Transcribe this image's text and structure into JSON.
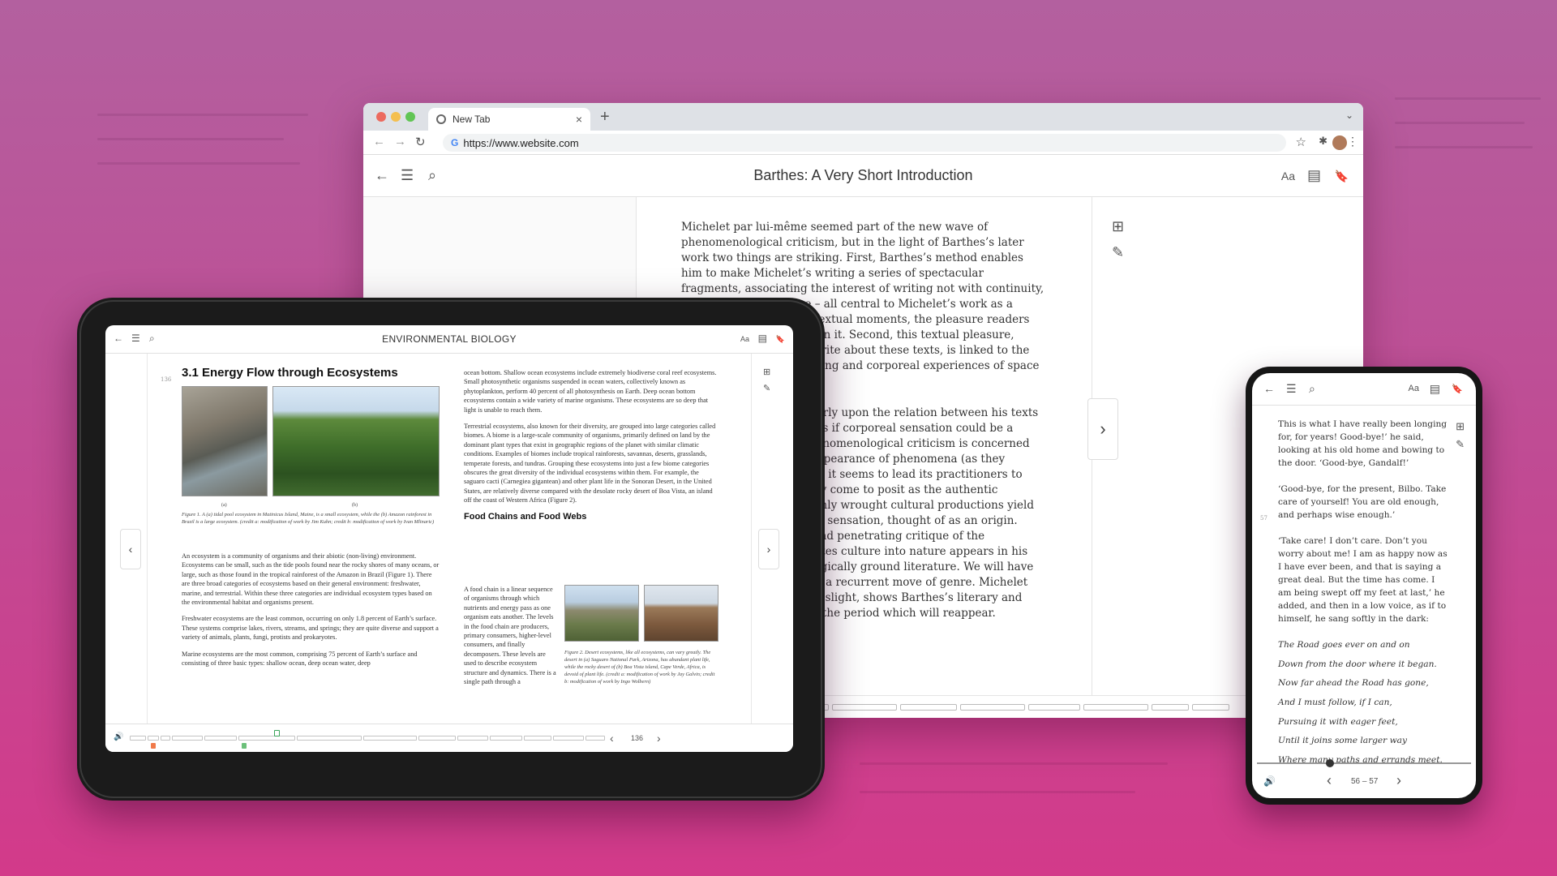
{
  "browser": {
    "tab_title": "New Tab",
    "tab_close": "×",
    "new_tab": "+",
    "tab_menu": "⌄",
    "url": "https://www.website.com",
    "google_letter": "G",
    "nav_back": "←",
    "nav_forward": "→",
    "nav_reload": "↻",
    "star": "☆",
    "extensions": "✱",
    "menu": "⋮"
  },
  "desktop_reader": {
    "title": "Barthes: A Very Short Introduction",
    "back_icon": "←",
    "toc_icon": "☰",
    "search_icon": "⌕",
    "font_icon": "Aa",
    "notes_icon": "▤",
    "bookmark_icon": "🔖",
    "add_note_icon": "⊞",
    "highlight_icon": "✎",
    "next_icon": "›",
    "paragraphs": [
      "Michelet par lui-même seemed part of the new wave of phenomenological criticism, but in the light of Barthes’s later work two things are striking. First, Barthes’s method enables him to make Michelet’s writing a series of spectacular fragments, associating the interest of writing not with continuity, development, structure – all central to Michelet’s work as a historian – but with the textual moments, the pleasure readers can get from odd details in it. Second, this textual pleasure, which leads Barthes to write about these texts, is linked to the body. A concern with feeling and corporeal experiences of space and time.",
      "Barthes focuses particularly upon the relation between his texts and bodily experiences, as if corporeal sensation could be a foundation. Although phenomenological criticism is concerned with the experience or appearance of phenomena (as they appear to consciousness), it seems to lead its practitioners to corporeal experience they come to posit as the authentic foundation. The most highly wrought cultural productions yield elementary, pre-reflective sensation, thought of as an origin. Barthes’s most incisive and penetrating critique of the mystification that translates culture into nature appears in his later works, which strategically ground literature. We will have to ask whether this is not a recurrent move of genre. Michelet par lui-même, apparently slight, shows Barthes’s literary and political commitments of the period which will reappear."
    ]
  },
  "tablet_reader": {
    "title": "ENVIRONMENTAL BIOLOGY",
    "back_icon": "←",
    "toc_icon": "☰",
    "search_icon": "⌕",
    "font_icon": "Aa",
    "notes_icon": "▤",
    "bookmark_icon": "🔖",
    "add_note_icon": "⊞",
    "highlight_icon": "✎",
    "prev_icon": "‹",
    "next_icon": "›",
    "page_label": "136",
    "page_margin_number": "136",
    "volume_icon": "🔊",
    "heading": "3.1 Energy Flow through Ecosystems",
    "photo_labels": [
      "(a)",
      "(b)"
    ],
    "figure1_caption": "Figure 1. A (a) tidal pool ecosystem in Matinicus Island, Maine, is a small ecosystem, while the (b) Amazon rainforest in Brazil is a large ecosystem. (credit a: modification of work by Jim Kuhn; credit b: modification of work by Ivan Mlinaric)",
    "left_paragraphs": [
      "An ecosystem is a community of organisms and their abiotic (non-living) environment. Ecosystems can be small, such as the tide pools found near the rocky shores of many oceans, or large, such as those found in the tropical rainforest of the Amazon in Brazil (Figure 1). There are three broad categories of ecosystems based on their general environment: freshwater, marine, and terrestrial. Within these three categories are individual ecosystem types based on the environmental habitat and organisms present.",
      "Freshwater ecosystems are the least common, occurring on only 1.8 percent of Earth’s surface. These systems comprise lakes, rivers, streams, and springs; they are quite diverse and support a variety of animals, plants, fungi, protists and prokaryotes.",
      "Marine ecosystems are the most common, comprising 75 percent of Earth’s surface and consisting of three basic types: shallow ocean, deep ocean water, deep"
    ],
    "right_paragraphs": [
      "ocean bottom. Shallow ocean ecosystems include extremely biodiverse coral reef ecosystems. Small photosynthetic organisms suspended in ocean waters, collectively known as phytoplankton, perform 40 percent of all photosynthesis on Earth. Deep ocean bottom ecosystems contain a wide variety of marine organisms. These ecosystems are so deep that light is unable to reach them.",
      "Terrestrial ecosystems, also known for their diversity, are grouped into large categories called biomes. A biome is a large-scale community of organisms, primarily defined on land by the dominant plant types that exist in geographic regions of the planet with similar climatic conditions. Examples of biomes include tropical rainforests, savannas, deserts, grasslands, temperate forests, and tundras. Grouping these ecosystems into just a few biome categories obscures the great diversity of the individual ecosystems within them. For example, the saguaro cacti (Carnegiea gigantean) and other plant life in the Sonoran Desert, in the United States, are relatively diverse compared with the desolate rocky desert of Boa Vista, an island off the coast of Western Africa (Figure 2)."
    ],
    "subheading": "Food Chains and Food Webs",
    "food_chain_text": "A food chain is a linear sequence of organisms through which nutrients and energy pass as one organism eats another. The levels in the food chain are producers, primary consumers, higher-level consumers, and finally decomposers. These levels are used to describe ecosystem structure and dynamics. There is a single path through a",
    "figure2_caption": "Figure 2. Desert ecosystems, like all ecosystems, can vary greatly. The desert in (a) Saguaro National Park, Arizona, has abundant plant life, while the rocky desert of (b) Boa Vista island, Cape Verde, Africa, is devoid of plant life. (credit a: modification of work by Jay Galvin; credit b: modification of work by Ingo Wolbern)",
    "colors": {
      "bookmark_orange": "#f07a4a",
      "highlight_green": "#6cc07a",
      "position_green": "#3aa55a"
    }
  },
  "phone_reader": {
    "back_icon": "←",
    "toc_icon": "☰",
    "search_icon": "⌕",
    "font_icon": "Aa",
    "notes_icon": "▤",
    "bookmark_icon": "🔖",
    "add_note_icon": "⊞",
    "highlight_icon": "✎",
    "margin_number": "57",
    "paragraphs": [
      "This is what I have really been longing for, for years! Good-bye!’ he said, looking at his old home and bowing to the door. ‘Good-bye, Gandalf!’",
      "‘Good-bye, for the present, Bilbo. Take care of yourself! You are old enough, and perhaps wise enough.’",
      "‘Take care! I don’t care. Don’t you worry about me! I am as happy now as I have ever been, and that is saying a great deal. But the time has come. I am being swept off my feet at last,’ he added, and then in a low voice, as if to himself, he sang softly in the dark:"
    ],
    "verse": [
      "The Road goes ever on and on",
      "Down from the door where it began.",
      "Now far ahead the Road has gone,",
      "And I must follow, if I can,",
      "Pursuing it with eager feet,",
      "Until it joins some larger way",
      "Where many paths and errands meet."
    ],
    "volume_icon": "🔊",
    "prev_icon": "‹",
    "next_icon": "›",
    "page_range": "56 – 57",
    "progress_fraction": 0.34
  }
}
